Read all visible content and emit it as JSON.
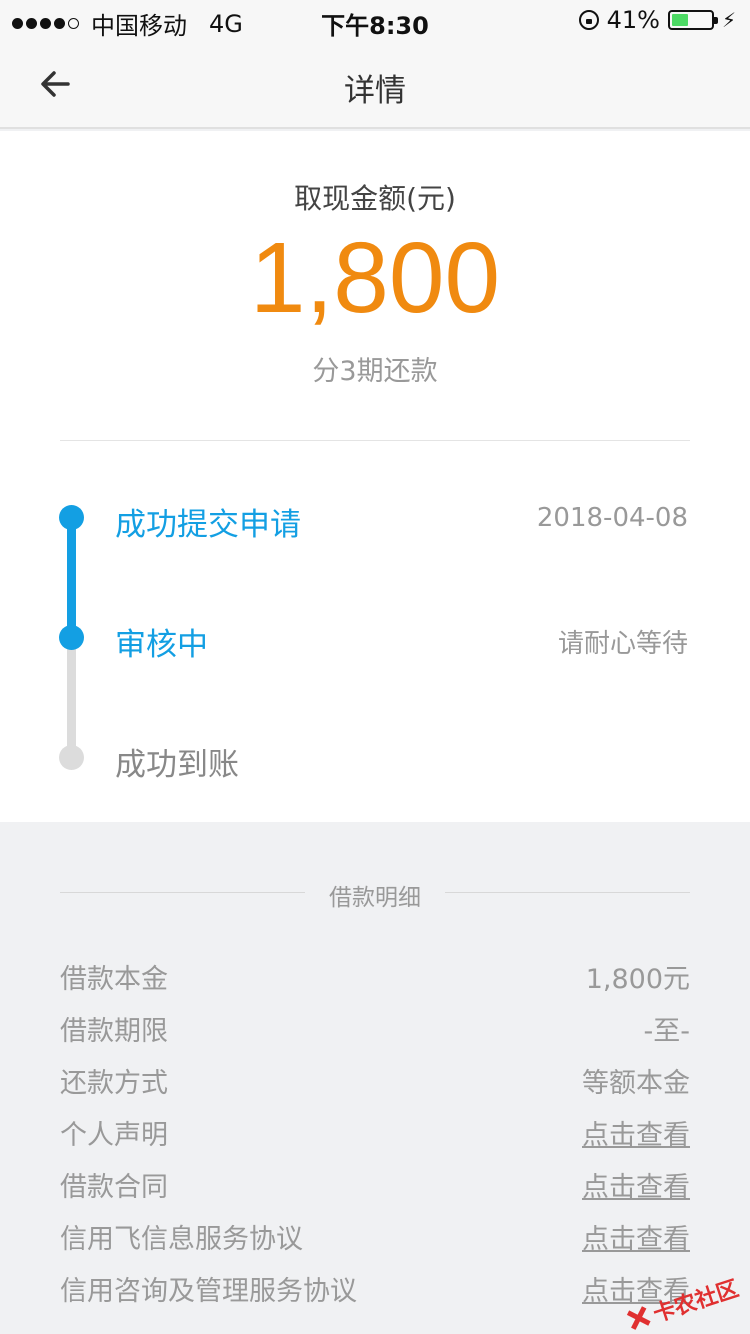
{
  "status_bar": {
    "carrier": "中国移动",
    "network": "4G",
    "time": "下午8:30",
    "battery": "41%",
    "battery_level": 0.41,
    "signal_bars": 4
  },
  "nav": {
    "title": "详情"
  },
  "summary": {
    "amount_label": "取现金额(元)",
    "amount_value": "1,800",
    "installments": "分3期还款"
  },
  "timeline": [
    {
      "label": "成功提交申请",
      "right": "2018-04-08",
      "status": "done"
    },
    {
      "label": "审核中",
      "right": "请耐心等待",
      "status": "current"
    },
    {
      "label": "成功到账",
      "right": "",
      "status": "pending"
    }
  ],
  "details": {
    "section_title": "借款明细",
    "rows": [
      {
        "label": "借款本金",
        "value": "1,800元",
        "link": false
      },
      {
        "label": "借款期限",
        "value": "-至-",
        "link": false
      },
      {
        "label": "还款方式",
        "value": "等额本金",
        "link": false
      },
      {
        "label": "个人声明",
        "value": "点击查看",
        "link": true
      },
      {
        "label": "借款合同",
        "value": "点击查看",
        "link": true
      },
      {
        "label": "信用飞信息服务协议",
        "value": "点击查看",
        "link": true
      },
      {
        "label": "信用咨询及管理服务协议",
        "value": "点击查看",
        "link": true
      }
    ]
  },
  "watermark": "卡农社区",
  "colors": {
    "accent_blue": "#139fe3",
    "amount_orange": "#f08a10",
    "battery_green": "#4cd964"
  }
}
